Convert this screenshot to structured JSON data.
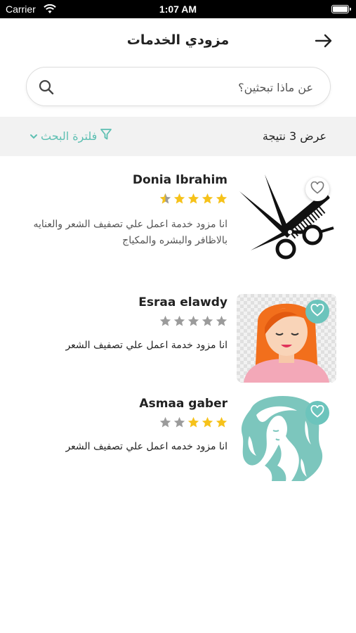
{
  "status_bar": {
    "carrier": "Carrier",
    "time": "1:07 AM"
  },
  "header": {
    "title": "مزودي الخدمات",
    "back_icon": "arrow-right-icon"
  },
  "search": {
    "placeholder": "عن ماذا تبحثين؟",
    "value": ""
  },
  "filter_bar": {
    "results_text": "عرض 3 نتيجة",
    "filter_label": "فلترة البحث"
  },
  "colors": {
    "accent": "#5dbfb2",
    "star_filled": "#f6c21a",
    "star_empty": "#9b9b9b"
  },
  "providers": [
    {
      "name": "Donia Ibrahim",
      "rating": 4.5,
      "description": "انا مزود خدمة اعمل علي تصفيف الشعر والعنايه بالاظافر والبشره والمكياج",
      "image": "scissors-comb-illustration",
      "favorite": false
    },
    {
      "name": "Esraa elawdy",
      "rating": 0,
      "description": "انا مزود خدمة اعمل علي تصفيف الشعر",
      "image": "red-hair-woman-illustration",
      "favorite": true
    },
    {
      "name": "Asmaa gaber",
      "rating": 3,
      "description": "انا مزود خدمه اعمل علي تصفيف الشعر",
      "image": "teal-hair-silhouette-illustration",
      "favorite": true
    }
  ]
}
